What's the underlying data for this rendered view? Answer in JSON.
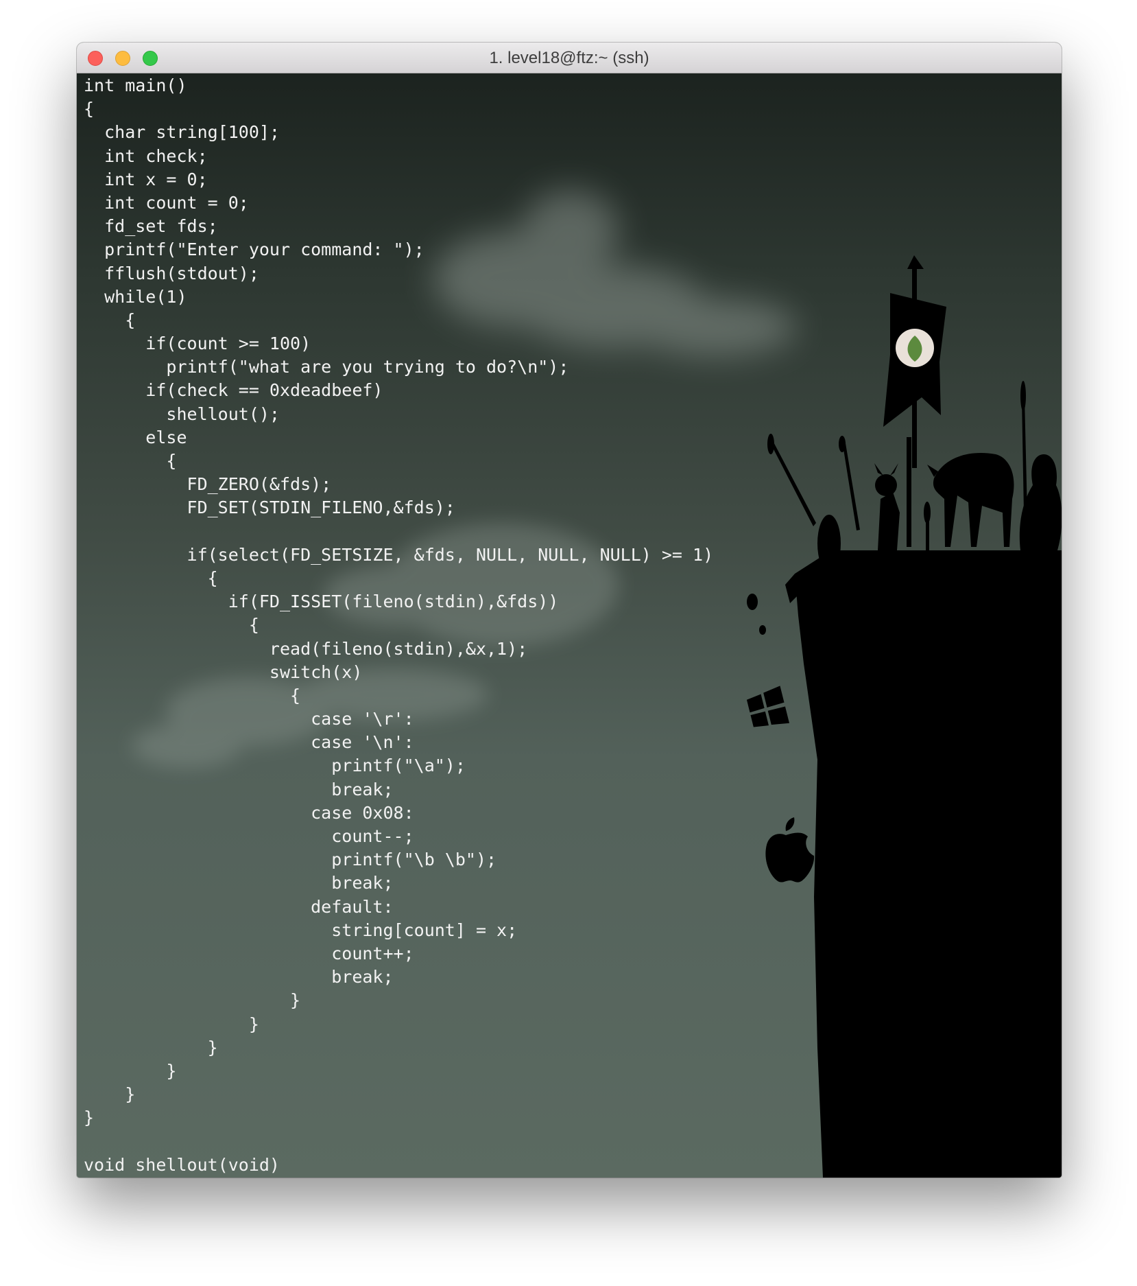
{
  "window": {
    "title": "1. level18@ftz:~ (ssh)"
  },
  "colors": {
    "close": "#fc605b",
    "minimize": "#fdbc40",
    "maximize": "#34c84a",
    "text": "#f2f2f2"
  },
  "icons": {
    "background": [
      "cloud-icon",
      "banner-flag-icon",
      "leaf-icon",
      "warrior-silhouette-icon",
      "bull-icon",
      "tux-penguin-icon",
      "windows-logo-icon",
      "apple-logo-icon"
    ]
  },
  "terminal": {
    "lines": [
      "int main()",
      "{",
      "  char string[100];",
      "  int check;",
      "  int x = 0;",
      "  int count = 0;",
      "  fd_set fds;",
      "  printf(\"Enter your command: \");",
      "  fflush(stdout);",
      "  while(1)",
      "    {",
      "      if(count >= 100)",
      "        printf(\"what are you trying to do?\\n\");",
      "      if(check == 0xdeadbeef)",
      "        shellout();",
      "      else",
      "        {",
      "          FD_ZERO(&fds);",
      "          FD_SET(STDIN_FILENO,&fds);",
      "",
      "          if(select(FD_SETSIZE, &fds, NULL, NULL, NULL) >= 1)",
      "            {",
      "              if(FD_ISSET(fileno(stdin),&fds))",
      "                {",
      "                  read(fileno(stdin),&x,1);",
      "                  switch(x)",
      "                    {",
      "                      case '\\r':",
      "                      case '\\n':",
      "                        printf(\"\\a\");",
      "                        break;",
      "                      case 0x08:",
      "                        count--;",
      "                        printf(\"\\b \\b\");",
      "                        break;",
      "                      default:",
      "                        string[count] = x;",
      "                        count++;",
      "                        break;",
      "                    }",
      "                }",
      "            }",
      "        }",
      "    }",
      "}",
      "",
      "void shellout(void)"
    ]
  }
}
